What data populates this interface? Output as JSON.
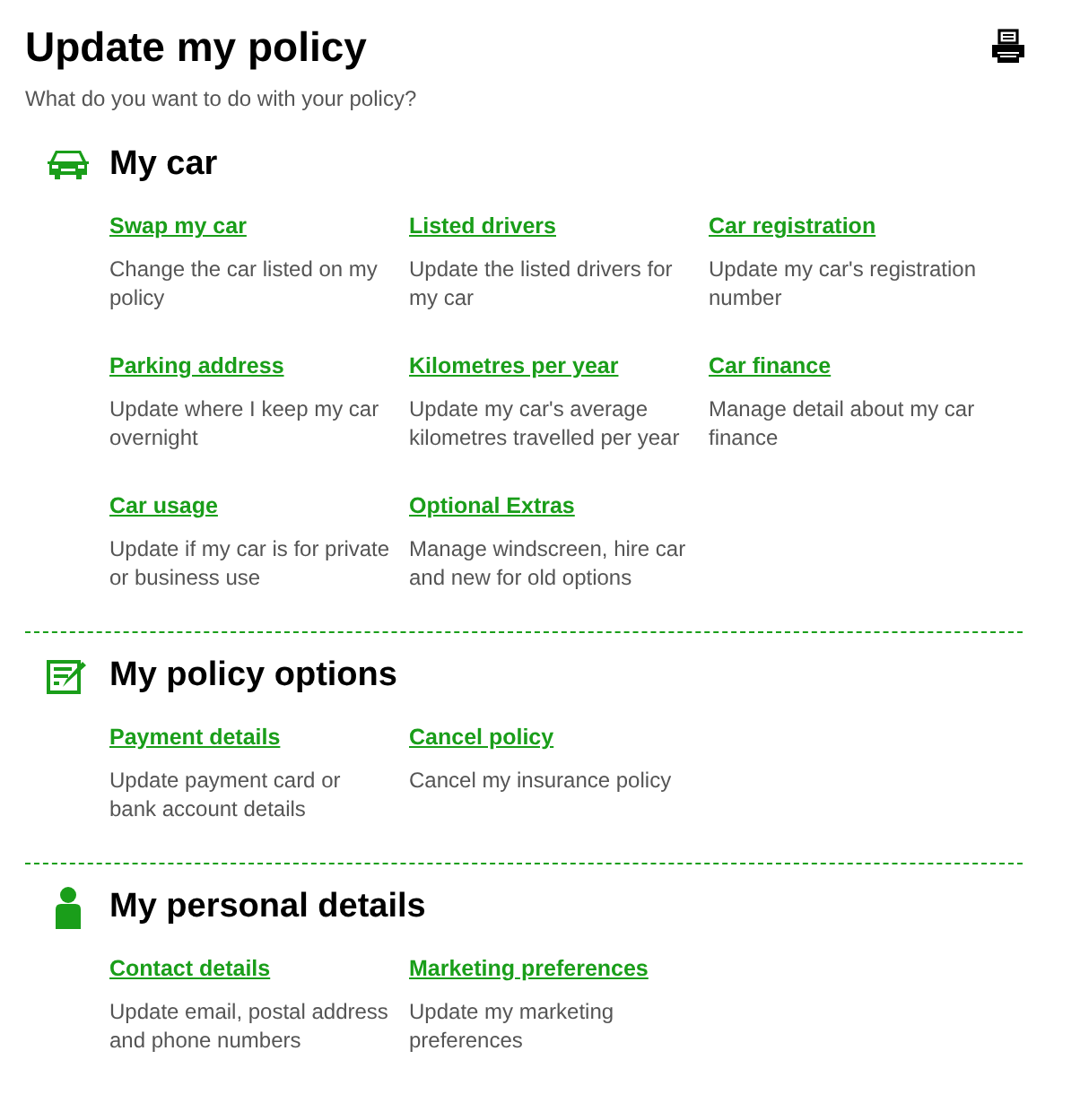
{
  "title": "Update my policy",
  "subtitle": "What do you want to do with your policy?",
  "sections": [
    {
      "kind": "car",
      "heading": "My car",
      "items": [
        {
          "link": "Swap my car",
          "description": "Change the car listed on my policy"
        },
        {
          "link": "Listed drivers",
          "description": "Update the listed drivers for my car"
        },
        {
          "link": "Car registration",
          "description": "Update my car's registration number"
        },
        {
          "link": "Parking address",
          "description": "Update where I keep my car overnight"
        },
        {
          "link": "Kilometres per year",
          "description": "Update my car's average kilometres travelled per year"
        },
        {
          "link": "Car finance",
          "description": "Manage detail about my car finance"
        },
        {
          "link": "Car usage",
          "description": "Update if my car is for private or business use"
        },
        {
          "link": "Optional Extras",
          "description": "Manage windscreen, hire car and new for old options"
        }
      ]
    },
    {
      "kind": "policy",
      "heading": "My policy options",
      "items": [
        {
          "link": "Payment details",
          "description": "Update payment card or bank account details"
        },
        {
          "link": "Cancel policy",
          "description": "Cancel my insurance policy"
        }
      ]
    },
    {
      "kind": "person",
      "heading": "My personal details",
      "items": [
        {
          "link": "Contact details",
          "description": "Update email, postal address and phone numbers"
        },
        {
          "link": "Marketing preferences",
          "description": "Update my marketing preferences"
        }
      ]
    }
  ]
}
